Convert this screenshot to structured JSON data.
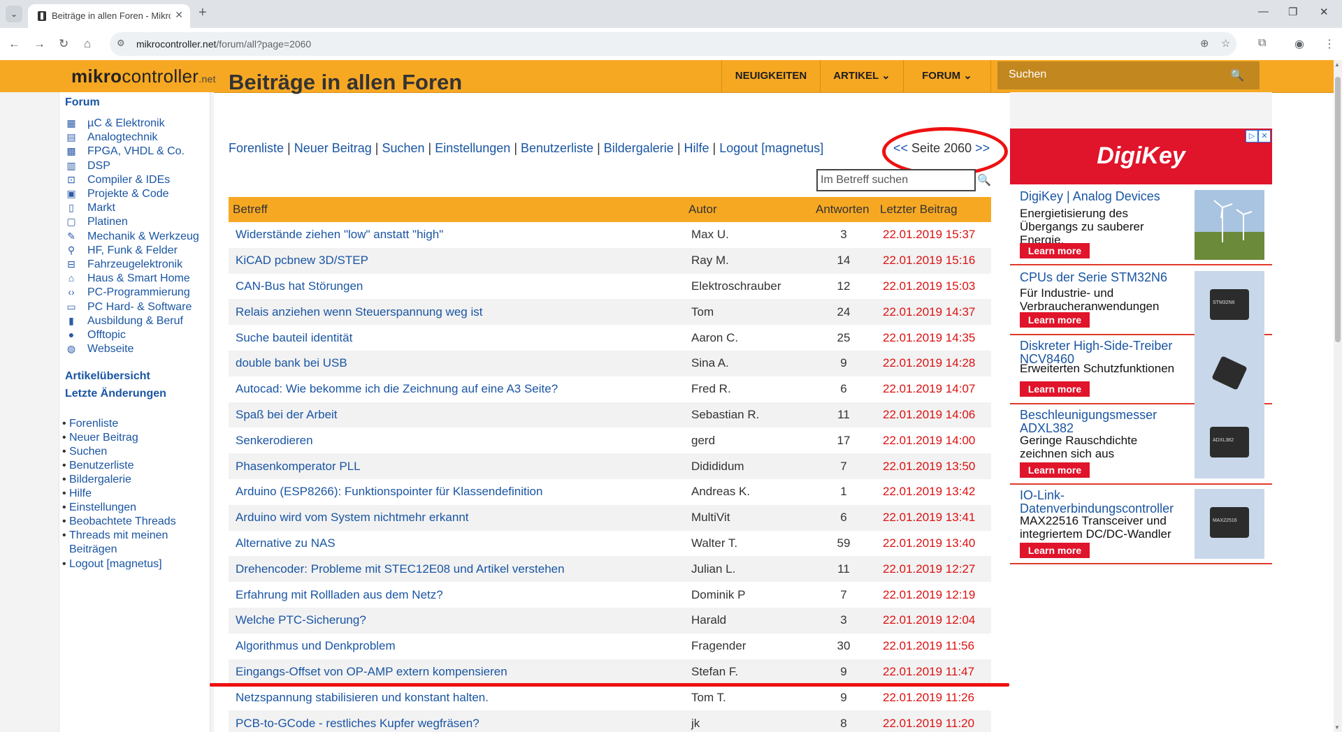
{
  "browser": {
    "tab_title": "Beiträge in allen Foren - Mikroc",
    "url_domain": "mikrocontroller.net",
    "url_path": "/forum/all?page=2060"
  },
  "header": {
    "logo_bold": "mikro",
    "logo_rest": "controller",
    "logo_suffix": ".net",
    "menu": [
      "NEUIGKEITEN",
      "ARTIKEL ⌄",
      "FORUM ⌄"
    ],
    "search_placeholder": "Suchen"
  },
  "sidebar": {
    "forum_heading": "Forum",
    "forums": [
      {
        "icon": "chip-icon",
        "glyph": "▦",
        "label": "µC & Elektronik"
      },
      {
        "icon": "analog-icon",
        "glyph": "▤",
        "label": "Analogtechnik"
      },
      {
        "icon": "fpga-icon",
        "glyph": "▩",
        "label": "FPGA, VHDL & Co."
      },
      {
        "icon": "dsp-icon",
        "glyph": "▥",
        "label": "DSP"
      },
      {
        "icon": "compiler-icon",
        "glyph": "⊡",
        "label": "Compiler & IDEs"
      },
      {
        "icon": "code-icon",
        "glyph": "▣",
        "label": "Projekte & Code"
      },
      {
        "icon": "cart-icon",
        "glyph": "▯",
        "label": "Markt"
      },
      {
        "icon": "board-icon",
        "glyph": "▢",
        "label": "Platinen"
      },
      {
        "icon": "wrench-icon",
        "glyph": "✎",
        "label": "Mechanik & Werkzeug"
      },
      {
        "icon": "antenna-icon",
        "glyph": "⚲",
        "label": "HF, Funk & Felder"
      },
      {
        "icon": "car-icon",
        "glyph": "⊟",
        "label": "Fahrzeugelektronik"
      },
      {
        "icon": "home-icon",
        "glyph": "⌂",
        "label": "Haus & Smart Home"
      },
      {
        "icon": "code-brackets-icon",
        "glyph": "‹›",
        "label": "PC-Programmierung"
      },
      {
        "icon": "monitor-icon",
        "glyph": "▭",
        "label": "PC Hard- & Software"
      },
      {
        "icon": "book-icon",
        "glyph": "▮",
        "label": "Ausbildung & Beruf"
      },
      {
        "icon": "chat-icon",
        "glyph": "●",
        "label": "Offtopic"
      },
      {
        "icon": "globe-icon",
        "glyph": "◍",
        "label": "Webseite"
      }
    ],
    "articles_overview": "Artikelübersicht",
    "latest_changes": "Letzte Änderungen",
    "links": [
      "Forenliste",
      "Neuer Beitrag",
      "Suchen",
      "Benutzerliste",
      "Bildergalerie",
      "Hilfe",
      "Einstellungen",
      "Beobachtete Threads",
      "Threads mit meinen",
      "Beiträgen",
      "Logout [magnetus]"
    ]
  },
  "main": {
    "title": "Beiträge in allen Foren",
    "nav_links": [
      "Forenliste",
      "Neuer Beitrag",
      "Suchen",
      "Einstellungen",
      "Benutzerliste",
      "Bildergalerie",
      "Hilfe",
      "Logout [magnetus]"
    ],
    "pager_prev": "<<",
    "pager_label": "Seite 2060",
    "pager_next": ">>",
    "subject_search_placeholder": "Im Betreff suchen",
    "table": {
      "headers": [
        "Betreff",
        "Autor",
        "Antworten",
        "Letzter Beitrag"
      ],
      "rows": [
        {
          "subject": "Widerstände ziehen \"low\" anstatt \"high\"",
          "author": "Max U.",
          "replies": "3",
          "last": "22.01.2019 15:37"
        },
        {
          "subject": "KiCAD pcbnew 3D/STEP",
          "author": "Ray M.",
          "replies": "14",
          "last": "22.01.2019 15:16"
        },
        {
          "subject": "CAN-Bus hat Störungen",
          "author": "Elektroschrauber",
          "replies": "12",
          "last": "22.01.2019 15:03"
        },
        {
          "subject": "Relais anziehen wenn Steuerspannung weg ist",
          "author": "Tom",
          "replies": "24",
          "last": "22.01.2019 14:37"
        },
        {
          "subject": "Suche bauteil identität",
          "author": "Aaron C.",
          "replies": "25",
          "last": "22.01.2019 14:35"
        },
        {
          "subject": "double bank bei USB",
          "author": "Sina A.",
          "replies": "9",
          "last": "22.01.2019 14:28"
        },
        {
          "subject": "Autocad: Wie bekomme ich die Zeichnung auf eine A3 Seite?",
          "author": "Fred R.",
          "replies": "6",
          "last": "22.01.2019 14:07"
        },
        {
          "subject": "Spaß bei der Arbeit",
          "author": "Sebastian R.",
          "replies": "11",
          "last": "22.01.2019 14:06"
        },
        {
          "subject": "Senkerodieren",
          "author": "gerd",
          "replies": "17",
          "last": "22.01.2019 14:00"
        },
        {
          "subject": "Phasenkomperator PLL",
          "author": "Didididum",
          "replies": "7",
          "last": "22.01.2019 13:50"
        },
        {
          "subject": "Arduino (ESP8266): Funktionspointer für Klassendefinition",
          "author": "Andreas K.",
          "replies": "1",
          "last": "22.01.2019 13:42"
        },
        {
          "subject": "Arduino wird vom System nichtmehr erkannt",
          "author": "MultiVit",
          "replies": "6",
          "last": "22.01.2019 13:41"
        },
        {
          "subject": "Alternative zu NAS",
          "author": "Walter T.",
          "replies": "59",
          "last": "22.01.2019 13:40"
        },
        {
          "subject": "Drehencoder: Probleme mit STEC12E08 und Artikel verstehen",
          "author": "Julian L.",
          "replies": "11",
          "last": "22.01.2019 12:27"
        },
        {
          "subject": "Erfahrung mit Rollladen aus dem Netz?",
          "author": "Dominik P",
          "replies": "7",
          "last": "22.01.2019 12:19"
        },
        {
          "subject": "Welche PTC-Sicherung?",
          "author": "Harald",
          "replies": "3",
          "last": "22.01.2019 12:04"
        },
        {
          "subject": "Algorithmus und Denkproblem",
          "author": "Fragender",
          "replies": "30",
          "last": "22.01.2019 11:56"
        },
        {
          "subject": "Eingangs-Offset von OP-AMP extern kompensieren",
          "author": "Stefan F.",
          "replies": "9",
          "last": "22.01.2019 11:47"
        },
        {
          "subject": "Netzspannung stabilisieren und konstant halten.",
          "author": "Tom T.",
          "replies": "9",
          "last": "22.01.2019 11:26"
        },
        {
          "subject": "PCB-to-GCode - restliches Kupfer wegfräsen?",
          "author": "jk",
          "replies": "8",
          "last": "22.01.2019 11:20"
        }
      ]
    }
  },
  "ads": {
    "brand": "DigiKey",
    "items": [
      {
        "title": "DigiKey | Analog Devices",
        "desc": "Energietisierung des Übergangs zu sauberer Energie.",
        "cta": "Learn more",
        "image": "wind-turbines-image"
      },
      {
        "title": "CPUs der Serie STM32N6",
        "desc": "Für Industrie- und Verbraucheranwendungen",
        "cta": "Learn more",
        "image": "stm32-chip-image",
        "chip_label": "STM32N6"
      },
      {
        "title": "Diskreter High-Side-Treiber NCV8460",
        "desc": "Erweiterten Schutzfunktionen",
        "cta": "Learn more",
        "image": "ncv8460-chip-image"
      },
      {
        "title": "Beschleunigungsmesser ADXL382",
        "desc": "Geringe Rauschdichte zeichnen sich aus",
        "cta": "Learn more",
        "image": "adxl382-chip-image",
        "chip_label": "ADXL382"
      },
      {
        "title": "IO-Link-Datenverbindungscontroller",
        "desc": "MAX22516 Transceiver und integriertem DC/DC-Wandler",
        "cta": "Learn more",
        "image": "max22516-chip-image",
        "chip_label": "MAX22516"
      }
    ]
  },
  "colors": {
    "accent": "#f7a823",
    "link": "#1a55a3",
    "date": "#dd1111",
    "annotation": "#ee1111",
    "ad_red": "#e0142a"
  }
}
